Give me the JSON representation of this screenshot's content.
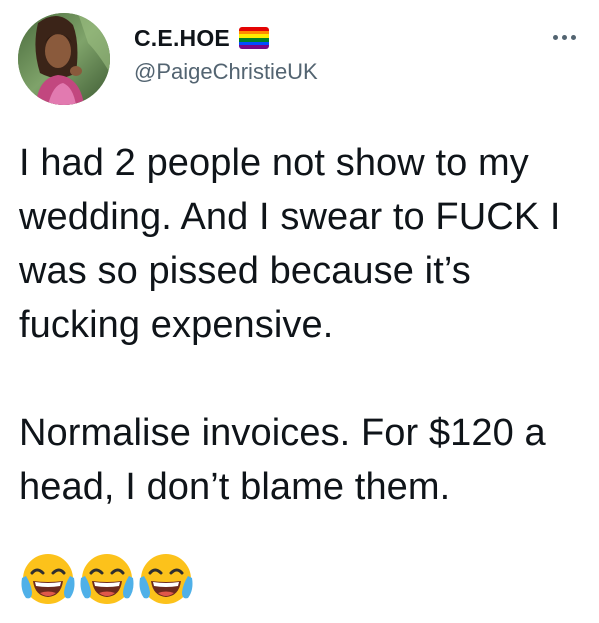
{
  "tweet": {
    "author": {
      "display_name": "C.E.HOE",
      "handle": "@PaigeChristieUK",
      "flag_icon": "rainbow-flag-icon",
      "flag_colors": [
        "#e40303",
        "#ff8c00",
        "#ffed00",
        "#008026",
        "#004dff",
        "#750787"
      ]
    },
    "more_icon": "more-options-icon",
    "body": {
      "paragraph_1": "I had 2 people not show to my wedding. And I swear to FUCK I was so pissed because it’s fucking expensive.",
      "paragraph_2": "Normalise invoices. For $120 a head, I don’t blame them."
    },
    "emojis": [
      "face-with-tears-of-joy-icon",
      "face-with-tears-of-joy-icon",
      "face-with-tears-of-joy-icon"
    ]
  },
  "colors": {
    "text": "#0f1419",
    "secondary_text": "#536471",
    "background": "#ffffff",
    "emoji_face": "#fcc21b",
    "emoji_tears": "#4fb0e8"
  }
}
